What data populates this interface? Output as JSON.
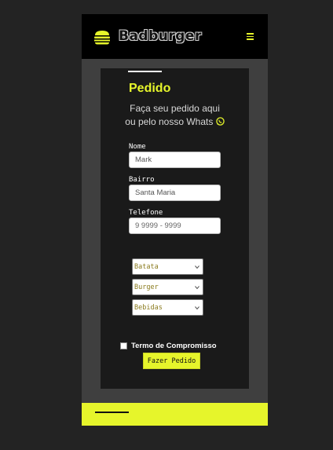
{
  "header": {
    "brand": "Badburger",
    "logo_icon": "burger-icon",
    "menu_icon": "hamburger-menu-icon"
  },
  "form": {
    "title": "Pedido",
    "subtitle_line1": "Faça seu pedido aqui",
    "subtitle_line2": "ou pelo nosso Whats",
    "whatsapp_icon": "whatsapp-icon",
    "fields": {
      "nome_label": "Nome",
      "nome_value": "Mark",
      "bairro_label": "Bairro",
      "bairro_value": "Santa Maria",
      "telefone_label": "Telefone",
      "telefone_placeholder": "9 9999 - 9999"
    },
    "selects": {
      "batata": "Batata",
      "burger": "Burger",
      "bebidas": "Bebidas"
    },
    "terms_label": "Termo de Compromisso",
    "submit_label": "Fazer Pedido"
  },
  "colors": {
    "accent": "#e6f52b",
    "background": "#232323",
    "card": "#1a1a1a"
  }
}
